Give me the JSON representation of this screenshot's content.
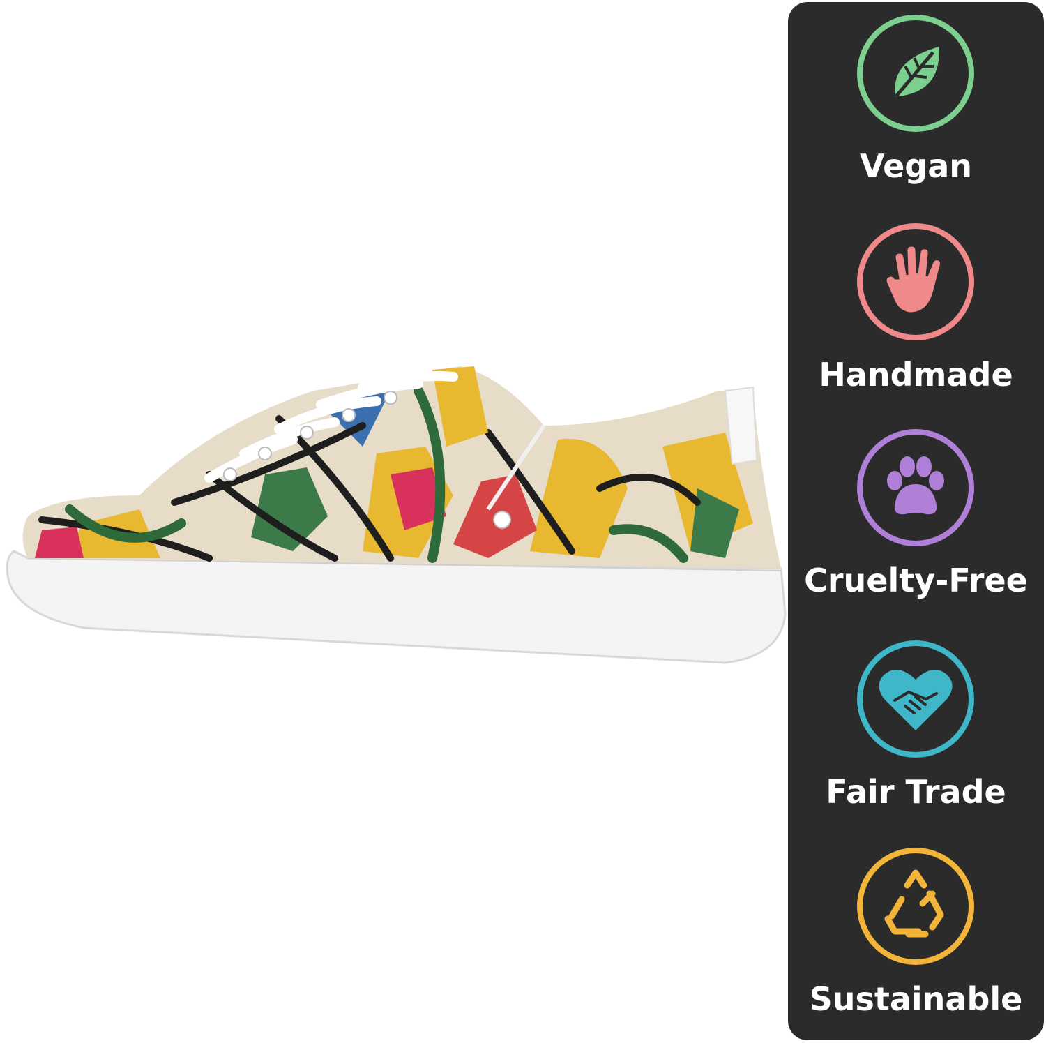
{
  "badges": [
    {
      "label": "Vegan",
      "icon": "leaf-icon",
      "color": "#7ccf8e"
    },
    {
      "label": "Handmade",
      "icon": "hand-icon",
      "color": "#f08a8a"
    },
    {
      "label": "Cruelty-Free",
      "icon": "paw-icon",
      "color": "#b07fd8"
    },
    {
      "label": "Fair Trade",
      "icon": "handshake-heart-icon",
      "color": "#3fb7c9"
    },
    {
      "label": "Sustainable",
      "icon": "recycle-icon",
      "color": "#f3b43a"
    }
  ],
  "panel_color": "#2b2b2b"
}
